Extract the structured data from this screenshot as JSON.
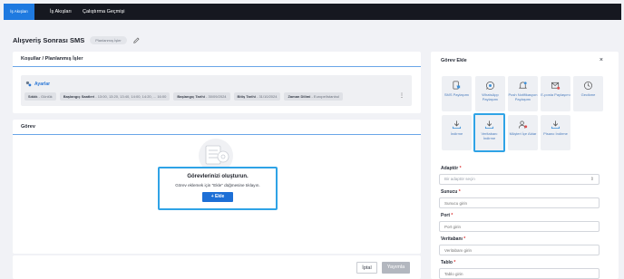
{
  "nav": {
    "tabs": [
      "İş Akışları",
      "İş Akışları",
      "Çalıştırma Geçmişi"
    ]
  },
  "page": {
    "title": "Alışveriş Sonrası SMS",
    "status": "Planlanmış İşler"
  },
  "conditions": {
    "header": "Koşullar / Planlanmış İşler",
    "settings_title": "Ayarlar",
    "chips": [
      {
        "k": "Sıklık",
        "v": " - Günlük"
      },
      {
        "k": "Başlangıç Saatleri",
        "v": " - 13:00, 13:20, 13:40, 14:00, 14:20, ... 16:00"
      },
      {
        "k": "Başlangıç Tarihi",
        "v": " - 30/09/2024"
      },
      {
        "k": "Bitiş Tarihi",
        "v": " - 31/10/2024"
      },
      {
        "k": "Zaman Dilimi",
        "v": " - Europe/Istanbul"
      }
    ]
  },
  "task": {
    "header": "Görev",
    "empty_title": "Görevlerinizi oluşturun.",
    "empty_sub": "Görev eklemek için \"Ekle\" düğmesine tıklayın.",
    "add_label": "+ Ekle"
  },
  "footer": {
    "cancel": "İptal",
    "publish": "Yayımla"
  },
  "panel": {
    "title": "Görev Ekle",
    "close": "×",
    "tiles": [
      {
        "label": "SMS Paylaşımı",
        "icon": "sms-icon"
      },
      {
        "label": "WhatsApp Paylaşımı",
        "icon": "whatsapp-icon"
      },
      {
        "label": "Push Notifikasyon Paylaşımı",
        "icon": "bell-icon"
      },
      {
        "label": "E-posta Paylaşımı",
        "icon": "mail-icon"
      },
      {
        "label": "Gecikme",
        "icon": "clock-icon"
      },
      {
        "label": "İndirme",
        "icon": "download-icon"
      },
      {
        "label": "Veritabanı İndirme",
        "icon": "database-download-icon"
      },
      {
        "label": "Müşteri İçe Aktar",
        "icon": "user-import-icon"
      },
      {
        "label": "Pisano İndirme",
        "icon": "download-icon"
      }
    ],
    "fields": [
      {
        "label": "Adaptör",
        "required": true,
        "placeholder": "Bir adaptör seçin",
        "select": true
      },
      {
        "label": "Sunucu",
        "required": true,
        "placeholder": "Sunucu girin"
      },
      {
        "label": "Port",
        "required": true,
        "placeholder": "Port girin"
      },
      {
        "label": "Veritabanı",
        "required": true,
        "placeholder": "Veritabanı girin"
      },
      {
        "label": "Tablo",
        "required": true,
        "placeholder": "Tablo girin"
      }
    ]
  }
}
